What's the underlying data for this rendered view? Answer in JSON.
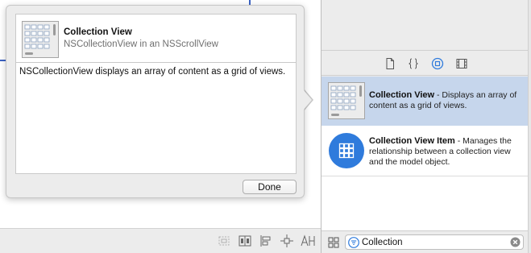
{
  "popover": {
    "title": "Collection View",
    "subtitle": "NSCollectionView in an NSScrollView",
    "description": "NSCollectionView displays an array of content as a grid of views.",
    "done_label": "Done"
  },
  "library": {
    "tabs": [
      {
        "name": "file-template-icon",
        "selected": false
      },
      {
        "name": "code-snippet-icon",
        "selected": false
      },
      {
        "name": "object-library-icon",
        "selected": true
      },
      {
        "name": "media-library-icon",
        "selected": false
      }
    ],
    "items": [
      {
        "name": "Collection View",
        "description": " - Displays an array of content as a grid of views.",
        "icon": "collection-view-icon",
        "selected": true
      },
      {
        "name": "Collection View Item",
        "description": " - Manages the relationship between a collection view and the model object.",
        "icon": "collection-view-item-icon",
        "selected": false
      }
    ],
    "search": {
      "value": "Collection",
      "placeholder": "Filter"
    }
  },
  "canvas_toolbar": {
    "buttons": [
      "embed-in-stack-icon",
      "align-icon",
      "distribute-icon",
      "pin-icon",
      "resolve-issues-icon"
    ]
  },
  "colors": {
    "selection": "#c6d6ec",
    "accent": "#2f7bdc",
    "guide": "#3b63c4"
  }
}
